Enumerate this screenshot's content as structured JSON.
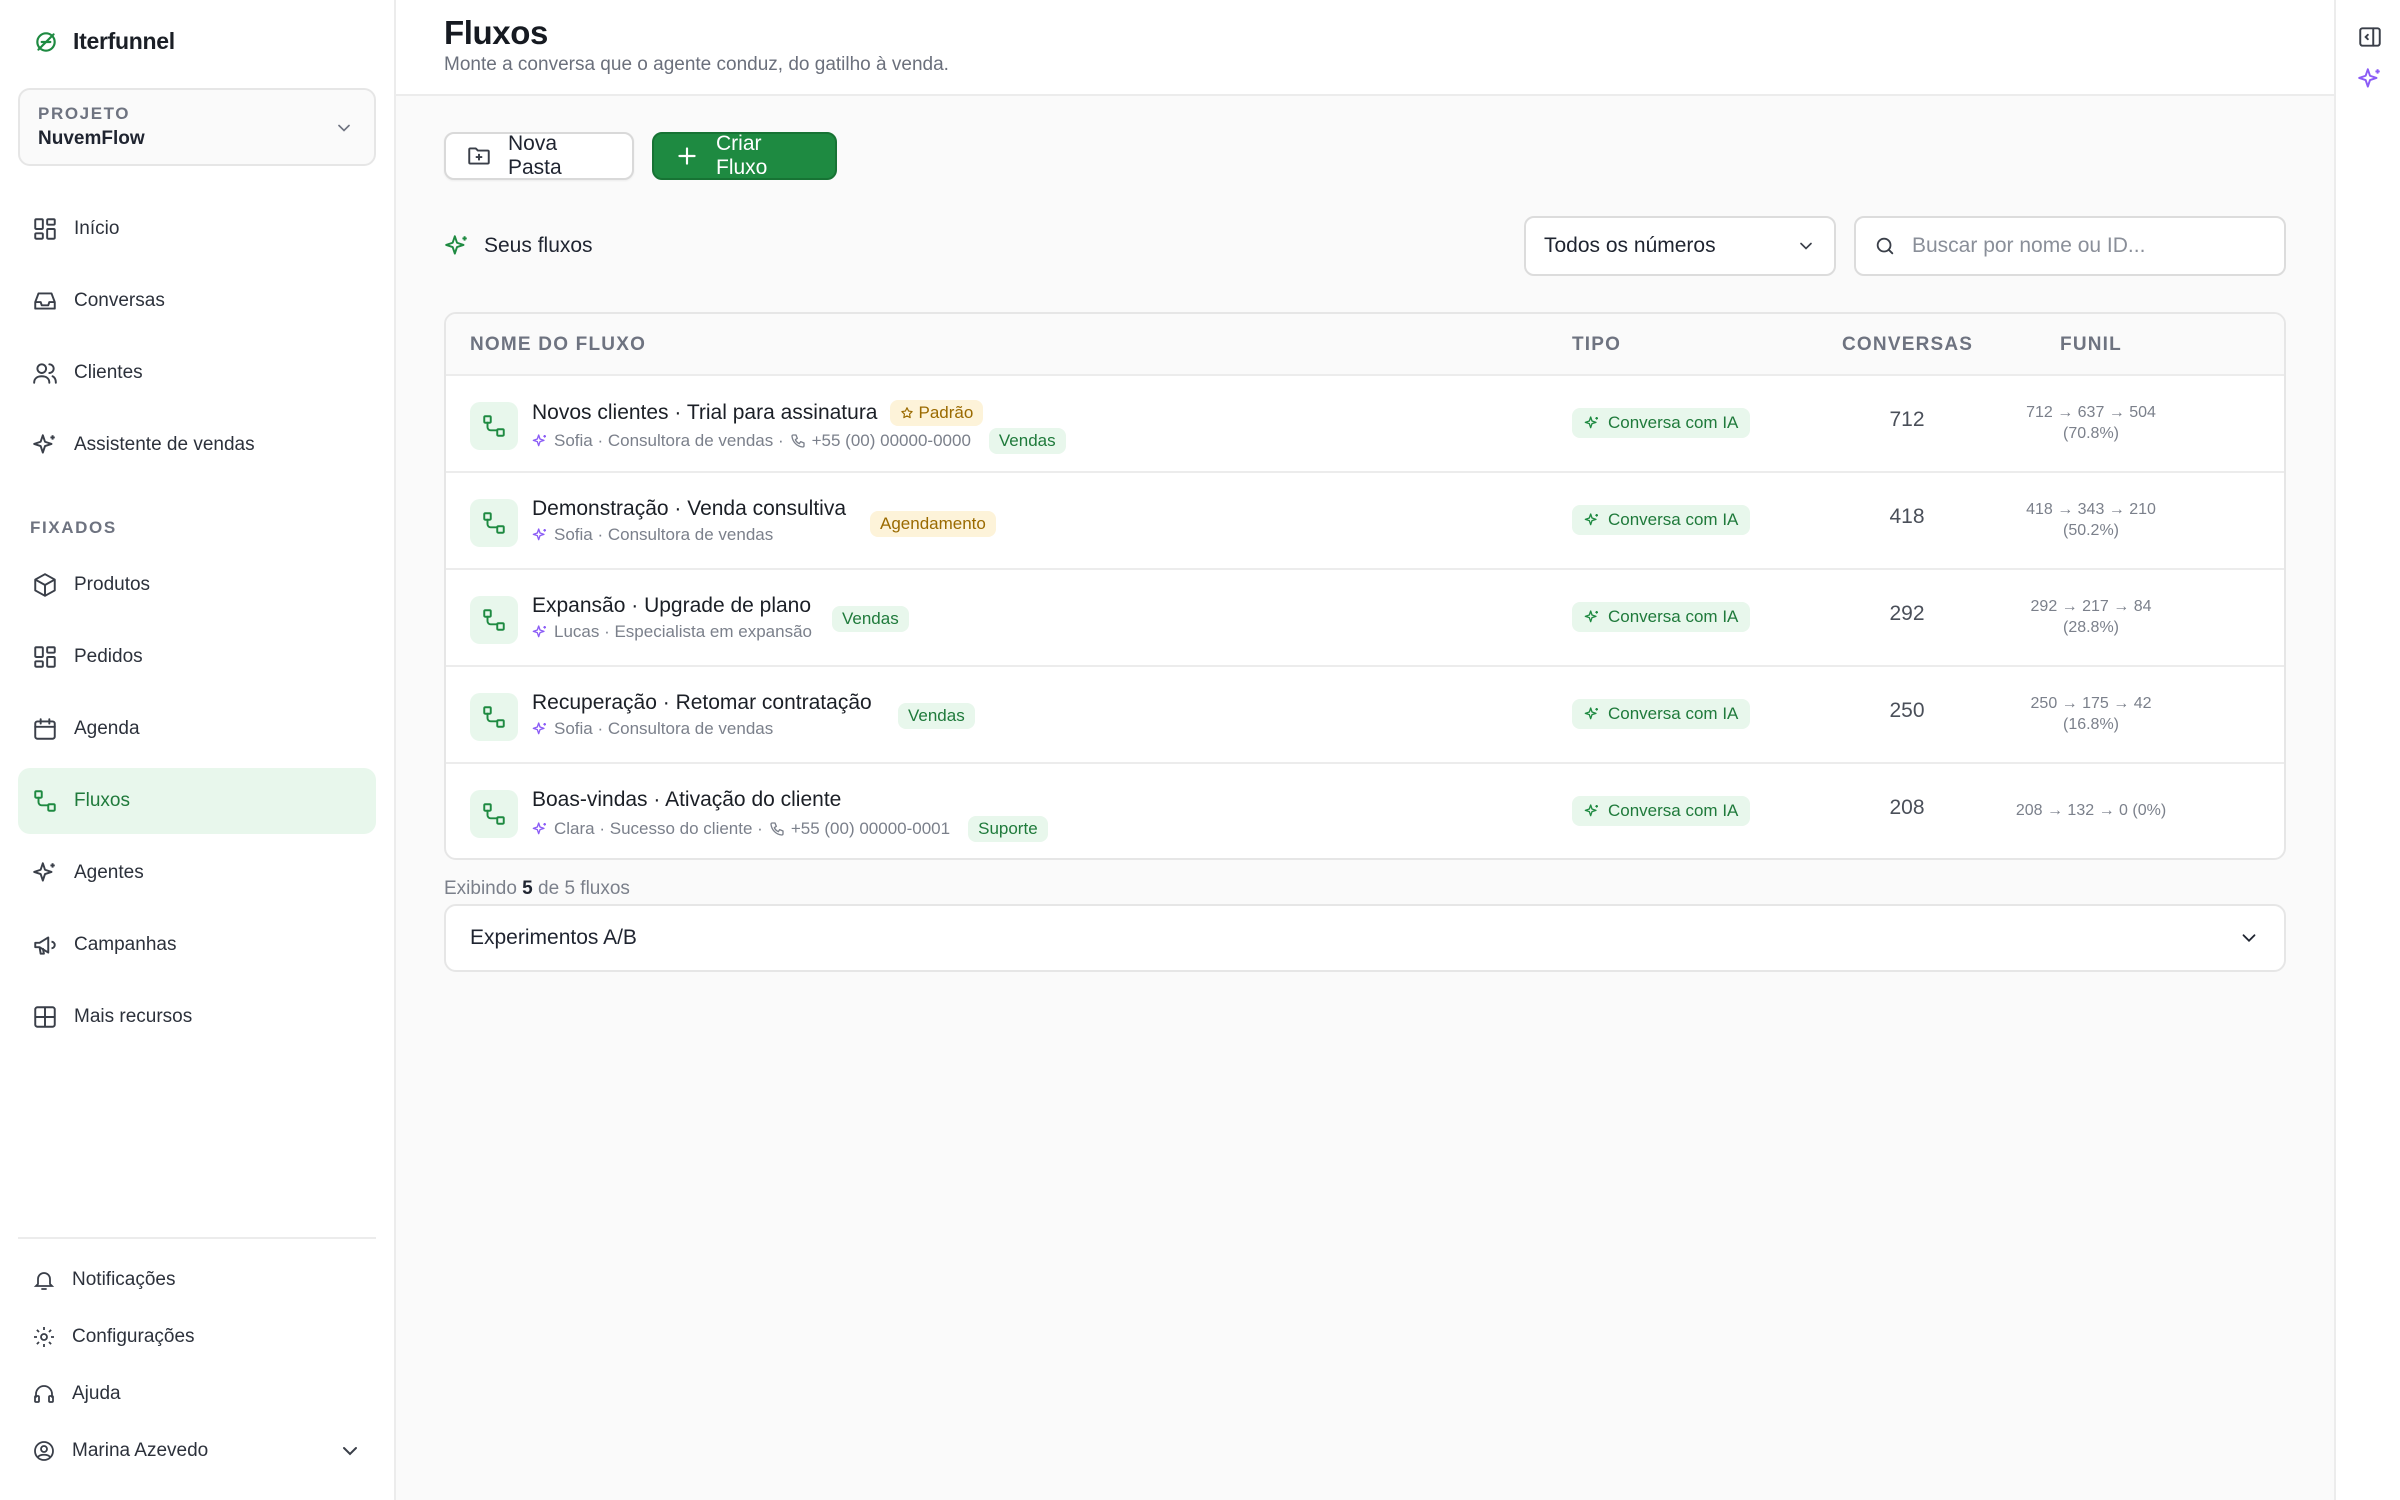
{
  "colors": {
    "accent": "#1e8a41",
    "accent_bg": "#e8f7ec",
    "amber": "#9a6a00",
    "amber_bg": "#fdf3d9",
    "ai_purple": "#8b5cf6"
  },
  "brand": {
    "name": "Iterfunnel"
  },
  "project": {
    "label": "PROJETO",
    "name": "NuvemFlow"
  },
  "nav": {
    "main": [
      "Início",
      "Conversas",
      "Clientes",
      "Assistente de vendas"
    ],
    "pinned_label": "FIXADOS",
    "pinned": [
      "Produtos",
      "Pedidos",
      "Agenda",
      "Fluxos",
      "Agentes",
      "Campanhas",
      "Mais recursos"
    ],
    "active": "Fluxos",
    "bottom": [
      "Notificações",
      "Configurações",
      "Ajuda"
    ],
    "user": "Marina Azevedo"
  },
  "header": {
    "title": "Fluxos",
    "subtitle": "Monte a conversa que o agente conduz, do gatilho à venda."
  },
  "actions": {
    "new_folder": "Nova Pasta",
    "create_flow": "Criar Fluxo"
  },
  "list": {
    "title": "Seus fluxos",
    "filter_value": "Todos os números",
    "search_placeholder": "Buscar por nome ou ID..."
  },
  "table": {
    "headers": {
      "name": "NOME DO FLUXO",
      "type": "TIPO",
      "conversations": "CONVERSAS",
      "funnel": "FUNIL"
    },
    "rows": [
      {
        "name": "Novos clientes · Trial para assinatura",
        "default_badge": "Padrão",
        "agent": "Sofia · Consultora de vendas ·",
        "phone": "+55 (00) 00000-0000",
        "tag": "Vendas",
        "tag_style": "green",
        "type": "Conversa com IA",
        "conversations": "712",
        "funnel_1": "712 → 637 → 504",
        "funnel_2": "(70.8%)"
      },
      {
        "name": "Demonstração · Venda consultiva",
        "agent": "Sofia · Consultora de vendas",
        "tag": "Agendamento",
        "tag_style": "amber",
        "type": "Conversa com IA",
        "conversations": "418",
        "funnel_1": "418 → 343 → 210",
        "funnel_2": "(50.2%)"
      },
      {
        "name": "Expansão · Upgrade de plano",
        "agent": "Lucas · Especialista em expansão",
        "tag": "Vendas",
        "tag_style": "green",
        "type": "Conversa com IA",
        "conversations": "292",
        "funnel_1": "292 → 217 → 84",
        "funnel_2": "(28.8%)"
      },
      {
        "name": "Recuperação · Retomar contratação",
        "agent": "Sofia · Consultora de vendas",
        "tag": "Vendas",
        "tag_style": "green",
        "type": "Conversa com IA",
        "conversations": "250",
        "funnel_1": "250 → 175 → 42",
        "funnel_2": "(16.8%)"
      },
      {
        "name": "Boas-vindas · Ativação do cliente",
        "agent": "Clara · Sucesso do cliente ·",
        "phone": "+55 (00) 00000-0001",
        "tag": "Suporte",
        "tag_style": "green",
        "type": "Conversa com IA",
        "conversations": "208",
        "funnel_1": "208 → 132 → 0 (0%)",
        "funnel_2": ""
      }
    ]
  },
  "footer": {
    "prefix": "Exibindo",
    "shown": "5",
    "suffix": "de 5 fluxos"
  },
  "accordion": {
    "label": "Experimentos A/B"
  }
}
